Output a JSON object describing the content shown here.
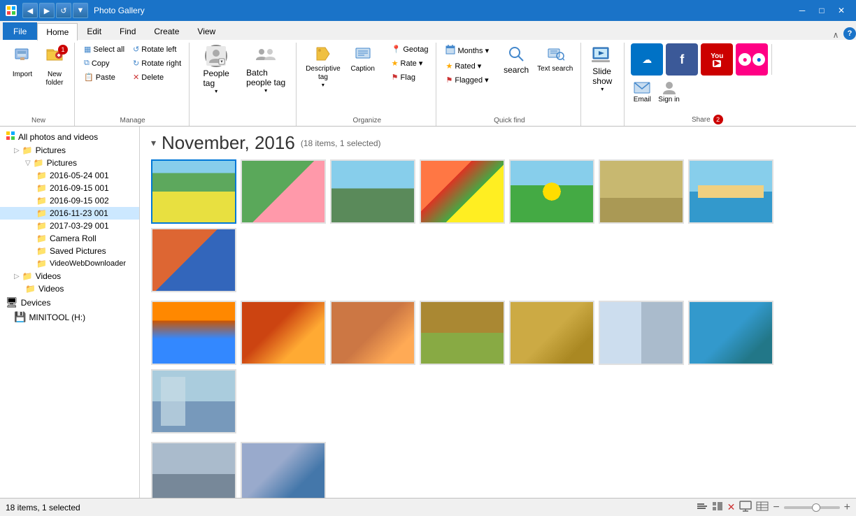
{
  "titleBar": {
    "title": "Photo Gallery",
    "minimize": "─",
    "maximize": "□",
    "close": "✕"
  },
  "nav": {
    "back": "◀",
    "forward": "▶",
    "up": "↑",
    "refresh": "↺",
    "down": "▼"
  },
  "ribbonTabs": {
    "file": "File",
    "home": "Home",
    "edit": "Edit",
    "find": "Find",
    "create": "Create",
    "view": "View"
  },
  "groups": {
    "new": {
      "label": "New",
      "import": "Import",
      "newFolder": "New\nfolder",
      "badge": "1"
    },
    "manage": {
      "label": "Manage",
      "selectAll": "Select all",
      "copy": "Copy",
      "paste": "Paste",
      "rotateLeft": "Rotate left",
      "rotateRight": "Rotate right",
      "delete": "Delete"
    },
    "people": {
      "label": "",
      "peopleTag": "People\ntag",
      "batchPeopleTag": "Batch\npeople tag"
    },
    "organize": {
      "label": "Organize",
      "descriptiveTag": "Descriptive\ntag",
      "caption": "Caption",
      "geotag": "Geotag",
      "rate": "Rate ▾",
      "flag": "Flag",
      "months": "Months ▾",
      "rated": "Rated ▾",
      "flagged": "Flagged ▾"
    },
    "quickFind": {
      "label": "Quick find",
      "search": "search",
      "textSearch": "Text\nsearch"
    },
    "slideshow": {
      "label": "",
      "slideshow": "Slide\nshow",
      "arrow": "▾"
    },
    "share": {
      "label": "Share",
      "badge": "2",
      "oneDrive": "☁",
      "facebook": "f",
      "youtube": "▶",
      "flickr": "⬤",
      "email": "Email",
      "signIn": "Sign\nin"
    },
    "collapse": "∧",
    "help": "?"
  },
  "sidebar": {
    "allPhotos": "All photos and videos",
    "pictures": "Pictures",
    "picturesFolder": "Pictures",
    "folders": [
      "2016-05-24 001",
      "2016-09-15 001",
      "2016-09-15 002",
      "2016-11-23 001",
      "2017-03-29 001",
      "Camera Roll",
      "Saved Pictures",
      "VideoWebDownloader"
    ],
    "videos": "Videos",
    "videosFolder": "Videos",
    "devices": "Devices",
    "minitool": "MINITOOL (H:)"
  },
  "content": {
    "monthTitle": "November, 2016",
    "monthInfo": "(18 items, 1 selected)"
  },
  "statusBar": {
    "left": "18 items, 1 selected",
    "zoomMinus": "−",
    "zoomPlus": "+"
  },
  "photos": [
    {
      "id": 1,
      "selected": true
    },
    {
      "id": 2
    },
    {
      "id": 3
    },
    {
      "id": 4
    },
    {
      "id": 5
    },
    {
      "id": 6
    },
    {
      "id": 7
    },
    {
      "id": 8
    },
    {
      "id": 9
    },
    {
      "id": 10
    },
    {
      "id": 11
    },
    {
      "id": 12
    },
    {
      "id": 13
    },
    {
      "id": 14
    },
    {
      "id": 15
    },
    {
      "id": 16
    },
    {
      "id": 17
    },
    {
      "id": 18
    }
  ]
}
